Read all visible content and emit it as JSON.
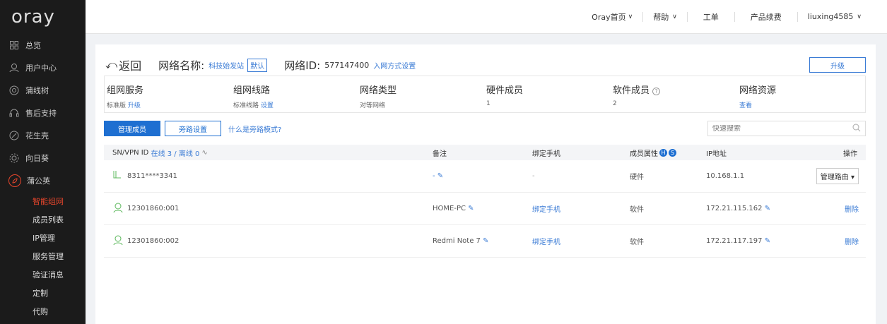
{
  "app": {
    "logo": "oray"
  },
  "sidebar": {
    "items": [
      {
        "label": "总览",
        "icon": "grid-icon"
      },
      {
        "label": "用户中心",
        "icon": "user-icon"
      },
      {
        "label": "蒲线树",
        "icon": "target-icon"
      },
      {
        "label": "售后支持",
        "icon": "headset-icon"
      },
      {
        "label": "花生壳",
        "icon": "peanut-icon"
      },
      {
        "label": "向日葵",
        "icon": "sunflower-icon"
      },
      {
        "label": "蒲公英",
        "icon": "dandelion-icon"
      }
    ],
    "subitems": [
      "智能组网",
      "成员列表",
      "IP管理",
      "服务管理",
      "验证消息",
      "定制",
      "代购"
    ]
  },
  "topbar": {
    "home": "Oray首页",
    "help": "帮助",
    "ticket": "工单",
    "renew": "产品续费",
    "user": "liuxing4585"
  },
  "header": {
    "back": "返回",
    "network_name_label": "网络名称:",
    "network_name_value": "科技始发站",
    "default_tag": "默认",
    "network_id_label": "网络ID:",
    "network_id_value": "577147400",
    "join_link": "入网方式设置",
    "upgrade": "升级"
  },
  "stats": [
    {
      "title": "组网服务",
      "value": "标准版",
      "link": "升级"
    },
    {
      "title": "组网线路",
      "value": "标准线路",
      "link": "设置"
    },
    {
      "title": "网络类型",
      "value": "对等网络",
      "link": ""
    },
    {
      "title": "硬件成员",
      "value": "1",
      "link": ""
    },
    {
      "title": "软件成员",
      "value": "2",
      "link": ""
    },
    {
      "title": "网络资源",
      "value": "",
      "link": "查看"
    }
  ],
  "toolbar": {
    "manage_members": "管理成员",
    "bypass_settings": "旁路设置",
    "bypass_help": "什么是旁路模式?",
    "search_placeholder": "快速搜索"
  },
  "table": {
    "headers": {
      "id": "SN/VPN ID",
      "online": "在线 3 / 离线 0",
      "remark": "备注",
      "phone": "绑定手机",
      "attr": "成员属性",
      "ip": "IP地址",
      "op": "操作"
    },
    "rows": [
      {
        "id": "8311****3341",
        "remark": "-",
        "phone": "-",
        "attr": "硬件",
        "ip": "10.168.1.1",
        "op": "管理路由"
      },
      {
        "id": "12301860:001",
        "remark": "HOME-PC",
        "phone": "绑定手机",
        "attr": "软件",
        "ip": "172.21.115.162",
        "op": "删除"
      },
      {
        "id": "12301860:002",
        "remark": "Redmi Note 7",
        "phone": "绑定手机",
        "attr": "软件",
        "ip": "172.21.117.197",
        "op": "删除"
      }
    ]
  },
  "colors": {
    "accent": "#1e6fd1",
    "brand": "#e8462c",
    "sidebar_bg": "#1b1b1b"
  }
}
